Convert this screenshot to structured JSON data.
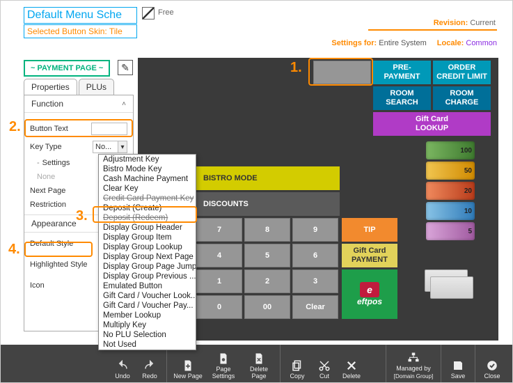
{
  "header": {
    "title": "Default Menu Sche",
    "skin_line": "Selected Button Skin: Tile",
    "free_label": "Free",
    "revision_label": "Revision:",
    "revision_value": "Current",
    "settings_for_label": "Settings for:",
    "settings_for_value": "Entire System",
    "locale_label": "Locale:",
    "locale_value": "Common"
  },
  "page_chip": "~ PAYMENT PAGE ~",
  "tabs": {
    "properties": "Properties",
    "plus": "PLUs"
  },
  "properties": {
    "function_section": "Function",
    "button_text_label": "Button Text",
    "button_text_value": "",
    "key_type_label": "Key Type",
    "key_type_value": "No...",
    "settings_label": "Settings",
    "settings_value": "None",
    "next_page_label": "Next Page",
    "restriction_label": "Restriction",
    "appearance_section": "Appearance",
    "default_style_label": "Default Style",
    "highlighted_style_label": "Highlighted Style",
    "icon_label": "Icon"
  },
  "key_type_options": [
    "Adjustment Key",
    "Bistro Mode Key",
    "Cash Machine Payment",
    "Clear Key",
    "Credit Card Payment Key",
    "Deposit (Create)",
    "Deposit (Redeem)",
    "Display Group Header",
    "Display Group Item",
    "Display Group Lookup",
    "Display Group Next Page",
    "Display Group Page Jump",
    "Display Group Previous ...",
    "Emulated Button",
    "Gift Card / Voucher Look...",
    "Gift Card / Voucher Pay...",
    "Member Lookup",
    "Multiply Key",
    "No PLU Selection",
    "Not Used"
  ],
  "grid": {
    "pre_payment": "PRE-\nPAYMENT",
    "order_credit_limit": "ORDER\nCREDIT LIMIT",
    "room_search": "ROOM\nSEARCH",
    "room_charge": "ROOM\nCHARGE",
    "gift_card_lookup": "Gift Card\nLOOKUP",
    "bistro_mode": "BISTRO MODE",
    "discounts": "DISCOUNTS",
    "keypad": {
      "k7": "7",
      "k8": "8",
      "k9": "9",
      "k4": "4",
      "k5": "5",
      "k6": "6",
      "k1": "1",
      "k2": "2",
      "k3": "3",
      "k0": "0",
      "k00": "00",
      "kclear": "Clear"
    },
    "tip": "TIP",
    "gift_card_payment": "Gift Card\nPAYMENT",
    "eftpos": "eftpos",
    "money": {
      "m100": "100",
      "m50": "50",
      "m20": "20",
      "m10": "10",
      "m5": "5"
    }
  },
  "callouts": {
    "c1": "1.",
    "c2": "2.",
    "c3": "3.",
    "c4": "4."
  },
  "toolbar": {
    "undo": "Undo",
    "redo": "Redo",
    "new_page": "New Page",
    "page_settings": "Page Settings",
    "delete_page": "Delete Page",
    "copy": "Copy",
    "cut": "Cut",
    "delete": "Delete",
    "managed_by": "Managed by",
    "managed_by_sub": "[Domain Group]",
    "save": "Save",
    "close": "Close"
  }
}
